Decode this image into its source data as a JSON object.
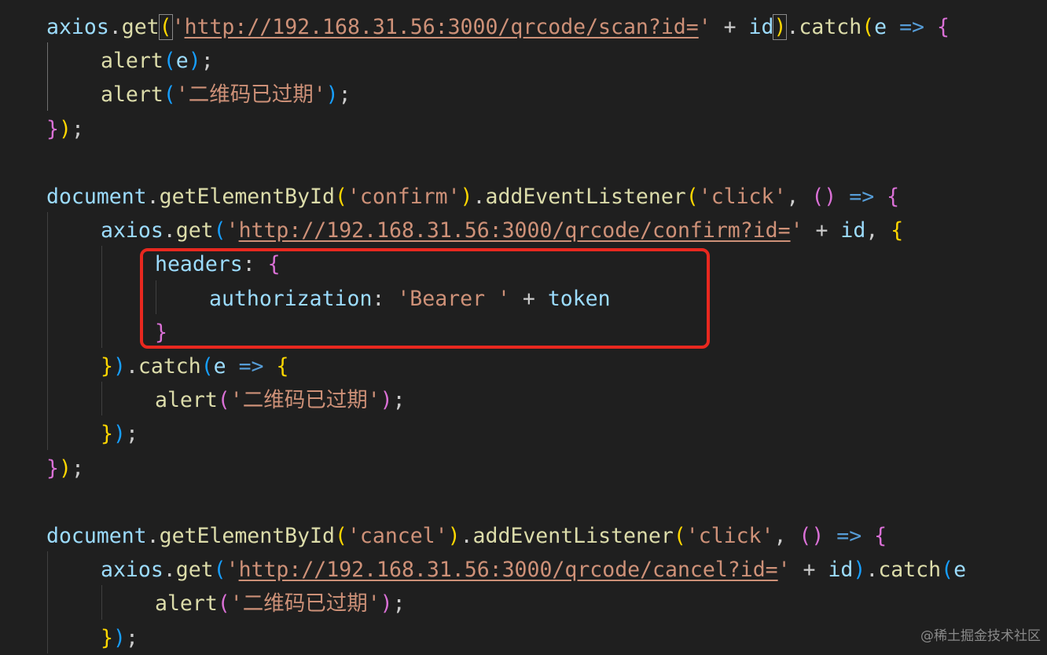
{
  "code": {
    "lines": [
      {
        "indent": 1,
        "tokens": [
          {
            "t": "axios",
            "c": "t-var"
          },
          {
            "t": ".",
            "c": "t-punc"
          },
          {
            "t": "get",
            "c": "t-fn"
          },
          {
            "t": "(",
            "c": "b1 bracket-match"
          },
          {
            "t": "'",
            "c": "t-str"
          },
          {
            "t": "http://192.168.31.56:3000/qrcode/scan?id=",
            "c": "t-url"
          },
          {
            "t": "'",
            "c": "t-str"
          },
          {
            "t": " + ",
            "c": "t-punc"
          },
          {
            "t": "id",
            "c": "t-var"
          },
          {
            "t": ")",
            "c": "b1 bracket-match"
          },
          {
            "t": ".",
            "c": "t-punc"
          },
          {
            "t": "catch",
            "c": "t-fn"
          },
          {
            "t": "(",
            "c": "b1"
          },
          {
            "t": "e",
            "c": "t-var"
          },
          {
            "t": " ",
            "c": "t-punc"
          },
          {
            "t": "=>",
            "c": "t-op"
          },
          {
            "t": " ",
            "c": "t-punc"
          },
          {
            "t": "{",
            "c": "b2"
          }
        ]
      },
      {
        "indent": 2,
        "tokens": [
          {
            "t": "alert",
            "c": "t-fn"
          },
          {
            "t": "(",
            "c": "b3"
          },
          {
            "t": "e",
            "c": "t-var"
          },
          {
            "t": ")",
            "c": "b3"
          },
          {
            "t": ";",
            "c": "t-punc"
          }
        ]
      },
      {
        "indent": 2,
        "tokens": [
          {
            "t": "alert",
            "c": "t-fn"
          },
          {
            "t": "(",
            "c": "b3"
          },
          {
            "t": "'二维码已过期'",
            "c": "t-str"
          },
          {
            "t": ")",
            "c": "b3"
          },
          {
            "t": ";",
            "c": "t-punc"
          }
        ]
      },
      {
        "indent": 1,
        "tokens": [
          {
            "t": "}",
            "c": "b2"
          },
          {
            "t": ")",
            "c": "b1"
          },
          {
            "t": ";",
            "c": "t-punc"
          }
        ]
      },
      {
        "indent": 0,
        "tokens": []
      },
      {
        "indent": 1,
        "tokens": [
          {
            "t": "document",
            "c": "t-var"
          },
          {
            "t": ".",
            "c": "t-punc"
          },
          {
            "t": "getElementById",
            "c": "t-fn"
          },
          {
            "t": "(",
            "c": "b1"
          },
          {
            "t": "'confirm'",
            "c": "t-str"
          },
          {
            "t": ")",
            "c": "b1"
          },
          {
            "t": ".",
            "c": "t-punc"
          },
          {
            "t": "addEventListener",
            "c": "t-fn"
          },
          {
            "t": "(",
            "c": "b1"
          },
          {
            "t": "'click'",
            "c": "t-str"
          },
          {
            "t": ", ",
            "c": "t-punc"
          },
          {
            "t": "()",
            "c": "b2"
          },
          {
            "t": " ",
            "c": "t-punc"
          },
          {
            "t": "=>",
            "c": "t-op"
          },
          {
            "t": " ",
            "c": "t-punc"
          },
          {
            "t": "{",
            "c": "b2"
          }
        ]
      },
      {
        "indent": 2,
        "tokens": [
          {
            "t": "axios",
            "c": "t-var"
          },
          {
            "t": ".",
            "c": "t-punc"
          },
          {
            "t": "get",
            "c": "t-fn"
          },
          {
            "t": "(",
            "c": "b3"
          },
          {
            "t": "'",
            "c": "t-str"
          },
          {
            "t": "http://192.168.31.56:3000/qrcode/confirm?id=",
            "c": "t-url"
          },
          {
            "t": "'",
            "c": "t-str"
          },
          {
            "t": " + ",
            "c": "t-punc"
          },
          {
            "t": "id",
            "c": "t-var"
          },
          {
            "t": ", ",
            "c": "t-punc"
          },
          {
            "t": "{",
            "c": "b1"
          }
        ]
      },
      {
        "indent": 3,
        "tokens": [
          {
            "t": "headers",
            "c": "t-prop"
          },
          {
            "t": ": ",
            "c": "t-punc"
          },
          {
            "t": "{",
            "c": "b2"
          }
        ]
      },
      {
        "indent": 4,
        "tokens": [
          {
            "t": "authorization",
            "c": "t-prop"
          },
          {
            "t": ": ",
            "c": "t-punc"
          },
          {
            "t": "'Bearer '",
            "c": "t-str"
          },
          {
            "t": " + ",
            "c": "t-punc"
          },
          {
            "t": "token",
            "c": "t-var"
          }
        ]
      },
      {
        "indent": 3,
        "tokens": [
          {
            "t": "}",
            "c": "b2"
          }
        ]
      },
      {
        "indent": 2,
        "tokens": [
          {
            "t": "}",
            "c": "b1"
          },
          {
            "t": ")",
            "c": "b3"
          },
          {
            "t": ".",
            "c": "t-punc"
          },
          {
            "t": "catch",
            "c": "t-fn"
          },
          {
            "t": "(",
            "c": "b3"
          },
          {
            "t": "e",
            "c": "t-var"
          },
          {
            "t": " ",
            "c": "t-punc"
          },
          {
            "t": "=>",
            "c": "t-op"
          },
          {
            "t": " ",
            "c": "t-punc"
          },
          {
            "t": "{",
            "c": "b1"
          }
        ]
      },
      {
        "indent": 3,
        "tokens": [
          {
            "t": "alert",
            "c": "t-fn"
          },
          {
            "t": "(",
            "c": "b2"
          },
          {
            "t": "'二维码已过期'",
            "c": "t-str"
          },
          {
            "t": ")",
            "c": "b2"
          },
          {
            "t": ";",
            "c": "t-punc"
          }
        ]
      },
      {
        "indent": 2,
        "tokens": [
          {
            "t": "}",
            "c": "b1"
          },
          {
            "t": ")",
            "c": "b3"
          },
          {
            "t": ";",
            "c": "t-punc"
          }
        ]
      },
      {
        "indent": 1,
        "tokens": [
          {
            "t": "}",
            "c": "b2"
          },
          {
            "t": ")",
            "c": "b1"
          },
          {
            "t": ";",
            "c": "t-punc"
          }
        ]
      },
      {
        "indent": 0,
        "tokens": []
      },
      {
        "indent": 1,
        "tokens": [
          {
            "t": "document",
            "c": "t-var"
          },
          {
            "t": ".",
            "c": "t-punc"
          },
          {
            "t": "getElementById",
            "c": "t-fn"
          },
          {
            "t": "(",
            "c": "b1"
          },
          {
            "t": "'cancel'",
            "c": "t-str"
          },
          {
            "t": ")",
            "c": "b1"
          },
          {
            "t": ".",
            "c": "t-punc"
          },
          {
            "t": "addEventListener",
            "c": "t-fn"
          },
          {
            "t": "(",
            "c": "b1"
          },
          {
            "t": "'click'",
            "c": "t-str"
          },
          {
            "t": ", ",
            "c": "t-punc"
          },
          {
            "t": "()",
            "c": "b2"
          },
          {
            "t": " ",
            "c": "t-punc"
          },
          {
            "t": "=>",
            "c": "t-op"
          },
          {
            "t": " ",
            "c": "t-punc"
          },
          {
            "t": "{",
            "c": "b2"
          }
        ]
      },
      {
        "indent": 2,
        "tokens": [
          {
            "t": "axios",
            "c": "t-var"
          },
          {
            "t": ".",
            "c": "t-punc"
          },
          {
            "t": "get",
            "c": "t-fn"
          },
          {
            "t": "(",
            "c": "b3"
          },
          {
            "t": "'",
            "c": "t-str"
          },
          {
            "t": "http://192.168.31.56:3000/qrcode/cancel?id=",
            "c": "t-url"
          },
          {
            "t": "'",
            "c": "t-str"
          },
          {
            "t": " + ",
            "c": "t-punc"
          },
          {
            "t": "id",
            "c": "t-var"
          },
          {
            "t": ")",
            "c": "b3"
          },
          {
            "t": ".",
            "c": "t-punc"
          },
          {
            "t": "catch",
            "c": "t-fn"
          },
          {
            "t": "(",
            "c": "b3"
          },
          {
            "t": "e",
            "c": "t-var"
          }
        ]
      },
      {
        "indent": 3,
        "tokens": [
          {
            "t": "alert",
            "c": "t-fn"
          },
          {
            "t": "(",
            "c": "b2"
          },
          {
            "t": "'二维码已过期'",
            "c": "t-str"
          },
          {
            "t": ")",
            "c": "b2"
          },
          {
            "t": ";",
            "c": "t-punc"
          }
        ]
      },
      {
        "indent": 2,
        "tokens": [
          {
            "t": "}",
            "c": "b1"
          },
          {
            "t": ")",
            "c": "b3"
          },
          {
            "t": ";",
            "c": "t-punc"
          }
        ]
      }
    ]
  },
  "watermark": "@稀土掘金技术社区"
}
